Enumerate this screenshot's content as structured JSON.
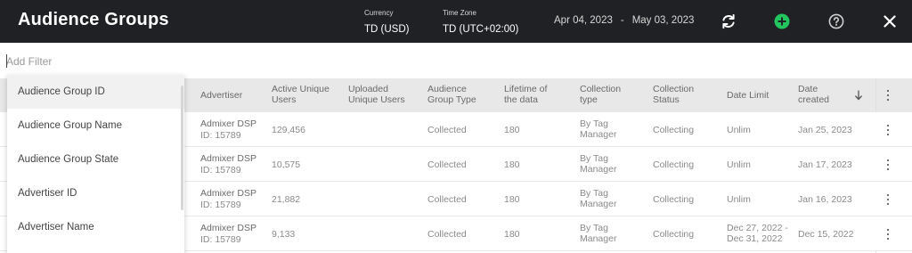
{
  "app": {
    "title": "Audience Groups"
  },
  "header": {
    "currency_caption": "Currency",
    "currency_value": "TD (USD)",
    "timezone_caption": "Time Zone",
    "timezone_value": "TD (UTC+02:00)",
    "date_from": "Apr 04, 2023",
    "date_separator": "-",
    "date_to": "May 03, 2023",
    "icons": [
      "refresh-icon",
      "add-icon",
      "help-icon",
      "close-icon"
    ],
    "colors": {
      "bar": "#202124",
      "add": "#22c55e"
    }
  },
  "filter": {
    "placeholder": "Add Filter"
  },
  "dropdown": {
    "items": [
      "Audience Group ID",
      "Audience Group Name",
      "Audience Group State",
      "Advertiser ID",
      "Advertiser Name"
    ],
    "active_index": 0
  },
  "table": {
    "columns": [
      "Advertiser",
      "Active Unique Users",
      "Uploaded Unique Users",
      "Audience Group Type",
      "Lifetime of the data",
      "Collection type",
      "Collection Status",
      "Date Limit",
      "Date created"
    ],
    "rows": [
      {
        "advertiser": "Admixer DSP",
        "advertiser_id": "ID: 15789",
        "active_users": "129,456",
        "uploaded_users": "",
        "type": "Collected",
        "lifetime": "180",
        "collection_type": "By Tag Manager",
        "status": "Collecting",
        "date_limit": "Unlim",
        "date_created": "Jan 25, 2023"
      },
      {
        "advertiser": "Admixer DSP",
        "advertiser_id": "ID: 15789",
        "active_users": "10,575",
        "uploaded_users": "",
        "type": "Collected",
        "lifetime": "180",
        "collection_type": "By Tag Manager",
        "status": "Collecting",
        "date_limit": "Unlim",
        "date_created": "Jan 17, 2023"
      },
      {
        "advertiser": "Admixer DSP",
        "advertiser_id": "ID: 15789",
        "active_users": "21,882",
        "uploaded_users": "",
        "type": "Collected",
        "lifetime": "180",
        "collection_type": "By Tag Manager",
        "status": "Collecting",
        "date_limit": "Unlim",
        "date_created": "Jan 16, 2023"
      },
      {
        "advertiser": "Admixer DSP",
        "advertiser_id": "ID: 15789",
        "active_users": "9,133",
        "uploaded_users": "",
        "type": "Collected",
        "lifetime": "180",
        "collection_type": "By Tag Manager",
        "status": "Collecting",
        "date_limit": "Dec 27, 2022 - Dec 31, 2022",
        "date_created": "Dec 15, 2022"
      }
    ]
  }
}
